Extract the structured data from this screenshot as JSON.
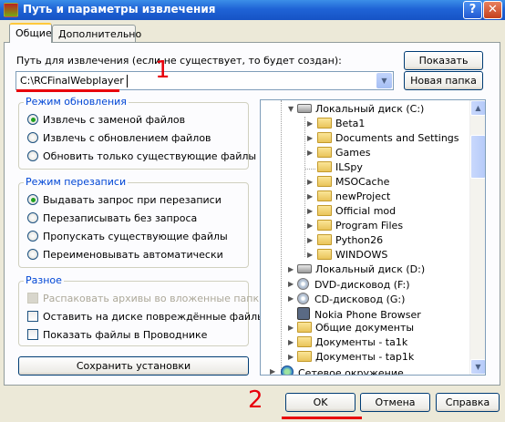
{
  "window": {
    "title": "Путь и параметры извлечения",
    "help_label": "?",
    "close_label": "✕"
  },
  "tabs": [
    {
      "label": "Общие",
      "active": true
    },
    {
      "label": "Дополнительно",
      "active": false
    }
  ],
  "path": {
    "label": "Путь для извлечения (если не существует, то будет создан):",
    "value": "C:\\RCFinalWebplayer",
    "annotation_number": "1"
  },
  "buttons": {
    "show": "Показать",
    "new_folder": "Новая папка",
    "save_settings": "Сохранить установки",
    "ok": "OK",
    "cancel": "Отмена",
    "help": "Справка"
  },
  "update_mode": {
    "legend": "Режим обновления",
    "options": [
      {
        "label": "Извлечь с заменой файлов",
        "selected": true
      },
      {
        "label": "Извлечь с обновлением файлов",
        "selected": false
      },
      {
        "label": "Обновить только существующие файлы",
        "selected": false
      }
    ]
  },
  "overwrite_mode": {
    "legend": "Режим перезаписи",
    "options": [
      {
        "label": "Выдавать запрос при перезаписи",
        "selected": true
      },
      {
        "label": "Перезаписывать без запроса",
        "selected": false
      },
      {
        "label": "Пропускать существующие файлы",
        "selected": false
      },
      {
        "label": "Переименовывать автоматически",
        "selected": false
      }
    ]
  },
  "misc": {
    "legend": "Разное",
    "options": [
      {
        "label": "Распаковать архивы во вложенные папки",
        "checked": false,
        "disabled": true
      },
      {
        "label": "Оставить на диске повреждённые файлы",
        "checked": false,
        "disabled": false
      },
      {
        "label": "Показать файлы в Проводнике",
        "checked": false,
        "disabled": false
      }
    ]
  },
  "tree": [
    {
      "label": "Локальный диск (C:)",
      "icon": "drive-icon",
      "expanded": true
    },
    {
      "label": "Beta1",
      "icon": "folder-icon"
    },
    {
      "label": "Documents and Settings",
      "icon": "folder-icon"
    },
    {
      "label": "Games",
      "icon": "folder-icon"
    },
    {
      "label": "ILSpy",
      "icon": "folder-icon"
    },
    {
      "label": "MSOCache",
      "icon": "folder-icon"
    },
    {
      "label": "newProject",
      "icon": "folder-icon"
    },
    {
      "label": "Official mod",
      "icon": "folder-icon"
    },
    {
      "label": "Program Files",
      "icon": "folder-icon"
    },
    {
      "label": "Python26",
      "icon": "folder-icon"
    },
    {
      "label": "WINDOWS",
      "icon": "folder-icon"
    },
    {
      "label": "Локальный диск (D:)",
      "icon": "drive-icon"
    },
    {
      "label": "DVD-дисковод (F:)",
      "icon": "disc-icon"
    },
    {
      "label": "CD-дисковод (G:)",
      "icon": "disc-icon"
    },
    {
      "label": "Nokia Phone Browser",
      "icon": "phone-icon"
    },
    {
      "label": "Общие документы",
      "icon": "folder-icon"
    },
    {
      "label": "Документы - ta1k",
      "icon": "folder-icon"
    },
    {
      "label": "Документы - tap1k",
      "icon": "folder-icon"
    },
    {
      "label": "Сетевое окружение",
      "icon": "globe-icon"
    }
  ],
  "footer": {
    "annotation_number": "2"
  },
  "colors": {
    "annotation": "#e8000b",
    "titlebar": "#1f63d6",
    "legend_text": "#0046d5"
  }
}
